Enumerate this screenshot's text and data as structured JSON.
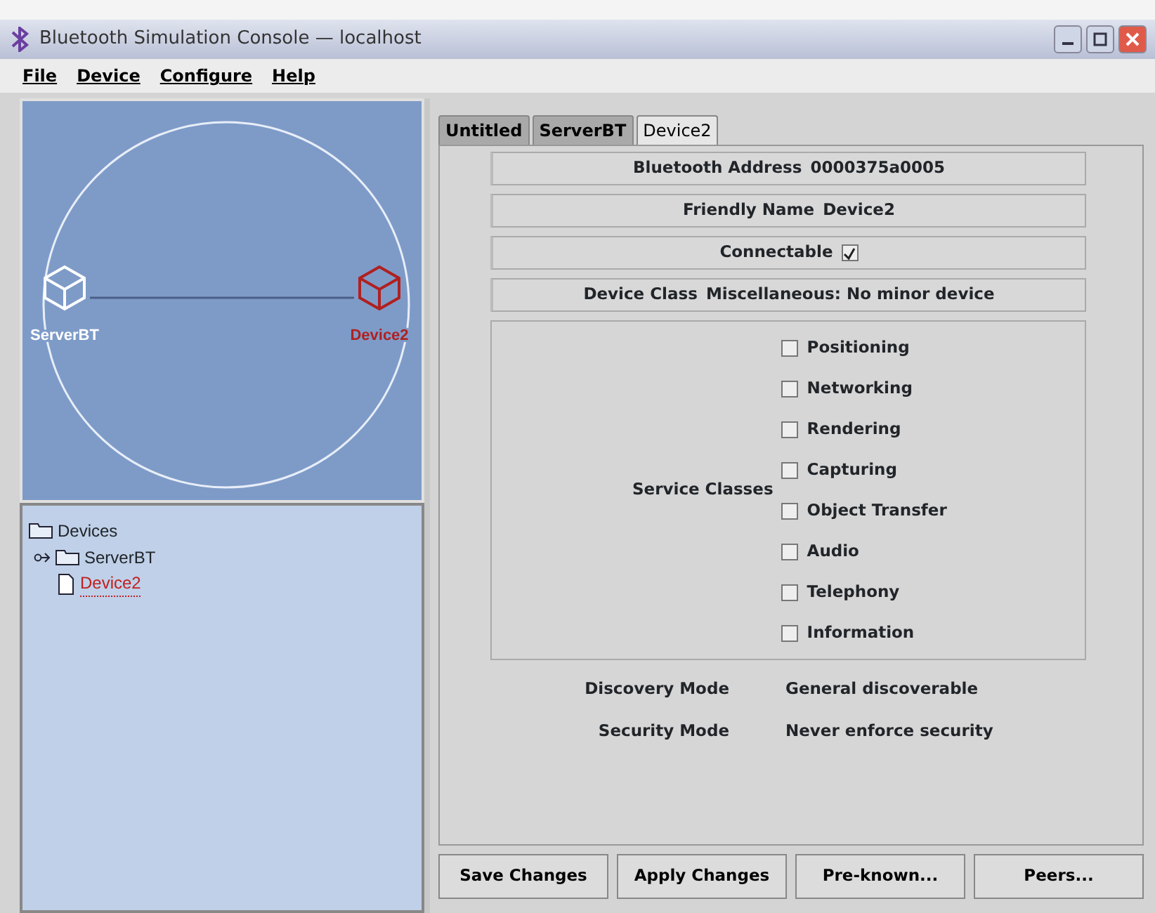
{
  "window": {
    "title": "Bluetooth Simulation Console — localhost"
  },
  "menu": [
    {
      "label": "File"
    },
    {
      "label": "Device"
    },
    {
      "label": "Configure"
    },
    {
      "label": "Help"
    }
  ],
  "graph": {
    "nodes": [
      {
        "label": "ServerBT",
        "color": "#ffffff"
      },
      {
        "label": "Device2",
        "color": "#b02020"
      }
    ]
  },
  "tree": {
    "label": "Devices",
    "children": [
      {
        "label": "ServerBT",
        "kind": "folder",
        "expanded": false,
        "selected": false
      },
      {
        "label": "Device2",
        "kind": "file",
        "selected": true
      }
    ]
  },
  "tabs": [
    {
      "label": "Untitled",
      "selected": false
    },
    {
      "label": "ServerBT",
      "selected": false
    },
    {
      "label": "Device2",
      "selected": true
    }
  ],
  "properties": [
    {
      "kind": "text",
      "label": "Bluetooth Address",
      "value": "0000375a0005"
    },
    {
      "kind": "text",
      "label": "Friendly Name",
      "value": "Device2"
    },
    {
      "kind": "check",
      "label": "Connectable",
      "checked": true
    },
    {
      "kind": "text",
      "label": "Device Class",
      "value": "Miscellaneous: No minor device"
    }
  ],
  "service_classes": {
    "label": "Service Classes",
    "items": [
      {
        "label": "Positioning",
        "checked": false
      },
      {
        "label": "Networking",
        "checked": false
      },
      {
        "label": "Rendering",
        "checked": false
      },
      {
        "label": "Capturing",
        "checked": false
      },
      {
        "label": "Object Transfer",
        "checked": false
      },
      {
        "label": "Audio",
        "checked": false
      },
      {
        "label": "Telephony",
        "checked": false
      },
      {
        "label": "Information",
        "checked": false
      }
    ]
  },
  "modes": [
    {
      "label": "Discovery Mode",
      "value": "General discoverable"
    },
    {
      "label": "Security Mode",
      "value": "Never enforce security"
    }
  ],
  "buttons": [
    {
      "label": "Save Changes"
    },
    {
      "label": "Apply Changes"
    },
    {
      "label": "Pre-known..."
    },
    {
      "label": "Peers..."
    }
  ]
}
